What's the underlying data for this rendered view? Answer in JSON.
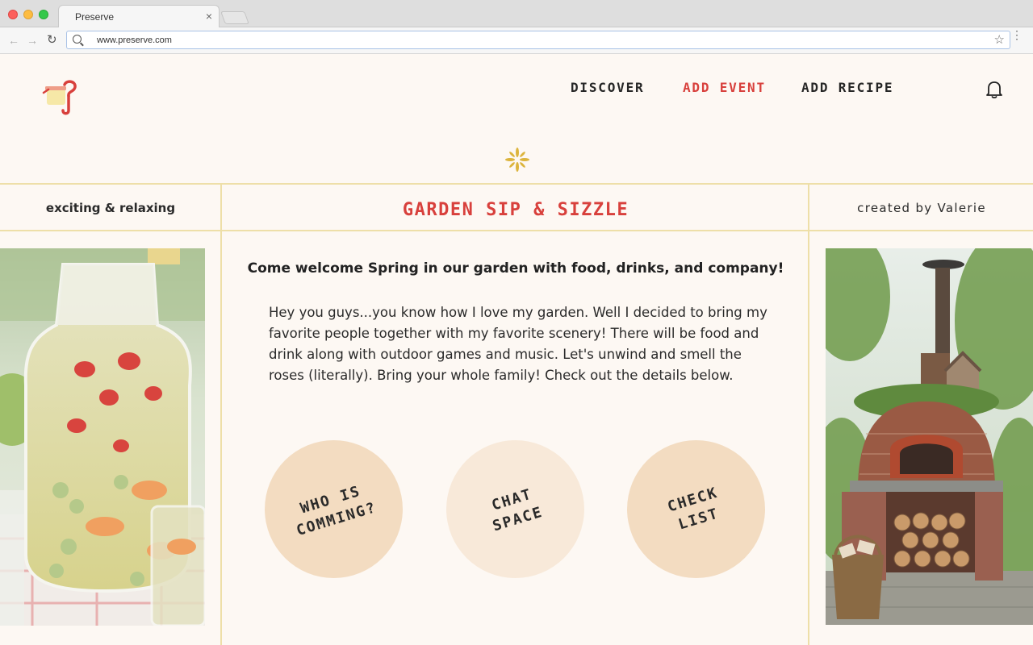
{
  "browser": {
    "tab_title": "Preserve",
    "tab_close": "×",
    "url": "www.preserve.com"
  },
  "nav": {
    "discover": "DISCOVER",
    "add_event": "ADD EVENT",
    "add_recipe": "ADD RECIPE"
  },
  "event": {
    "mood": "exciting & relaxing",
    "title": "GARDEN SIP & SIZZLE",
    "creator": "created by Valerie",
    "subtitle": "Come welcome Spring in our garden with food, drinks, and company!",
    "description": "Hey you guys...you know how I love my garden. Well I decided to bring my favorite people together with my favorite scenery! There will be food and drink along with outdoor games and music. Let's unwind and smell the roses (literally). Bring your whole family! Check out the details below.",
    "actions": {
      "who": "WHO IS\nCOMMING?",
      "chat": "CHAT\nSPACE",
      "checklist": "CHECK\nLIST"
    }
  },
  "colors": {
    "accent_red": "#d8403c",
    "background": "#fdf8f3",
    "grid_line": "#eedfa8",
    "circle_peach": "#f3dcc1",
    "circle_light": "#f8e9d9",
    "sparkle_gold": "#dcb43c"
  },
  "icons": {
    "logo": "preserve-jar-logo-icon",
    "bell": "bell-icon",
    "sparkle": "sparkle-icon",
    "search": "search-icon",
    "star": "star-icon"
  }
}
